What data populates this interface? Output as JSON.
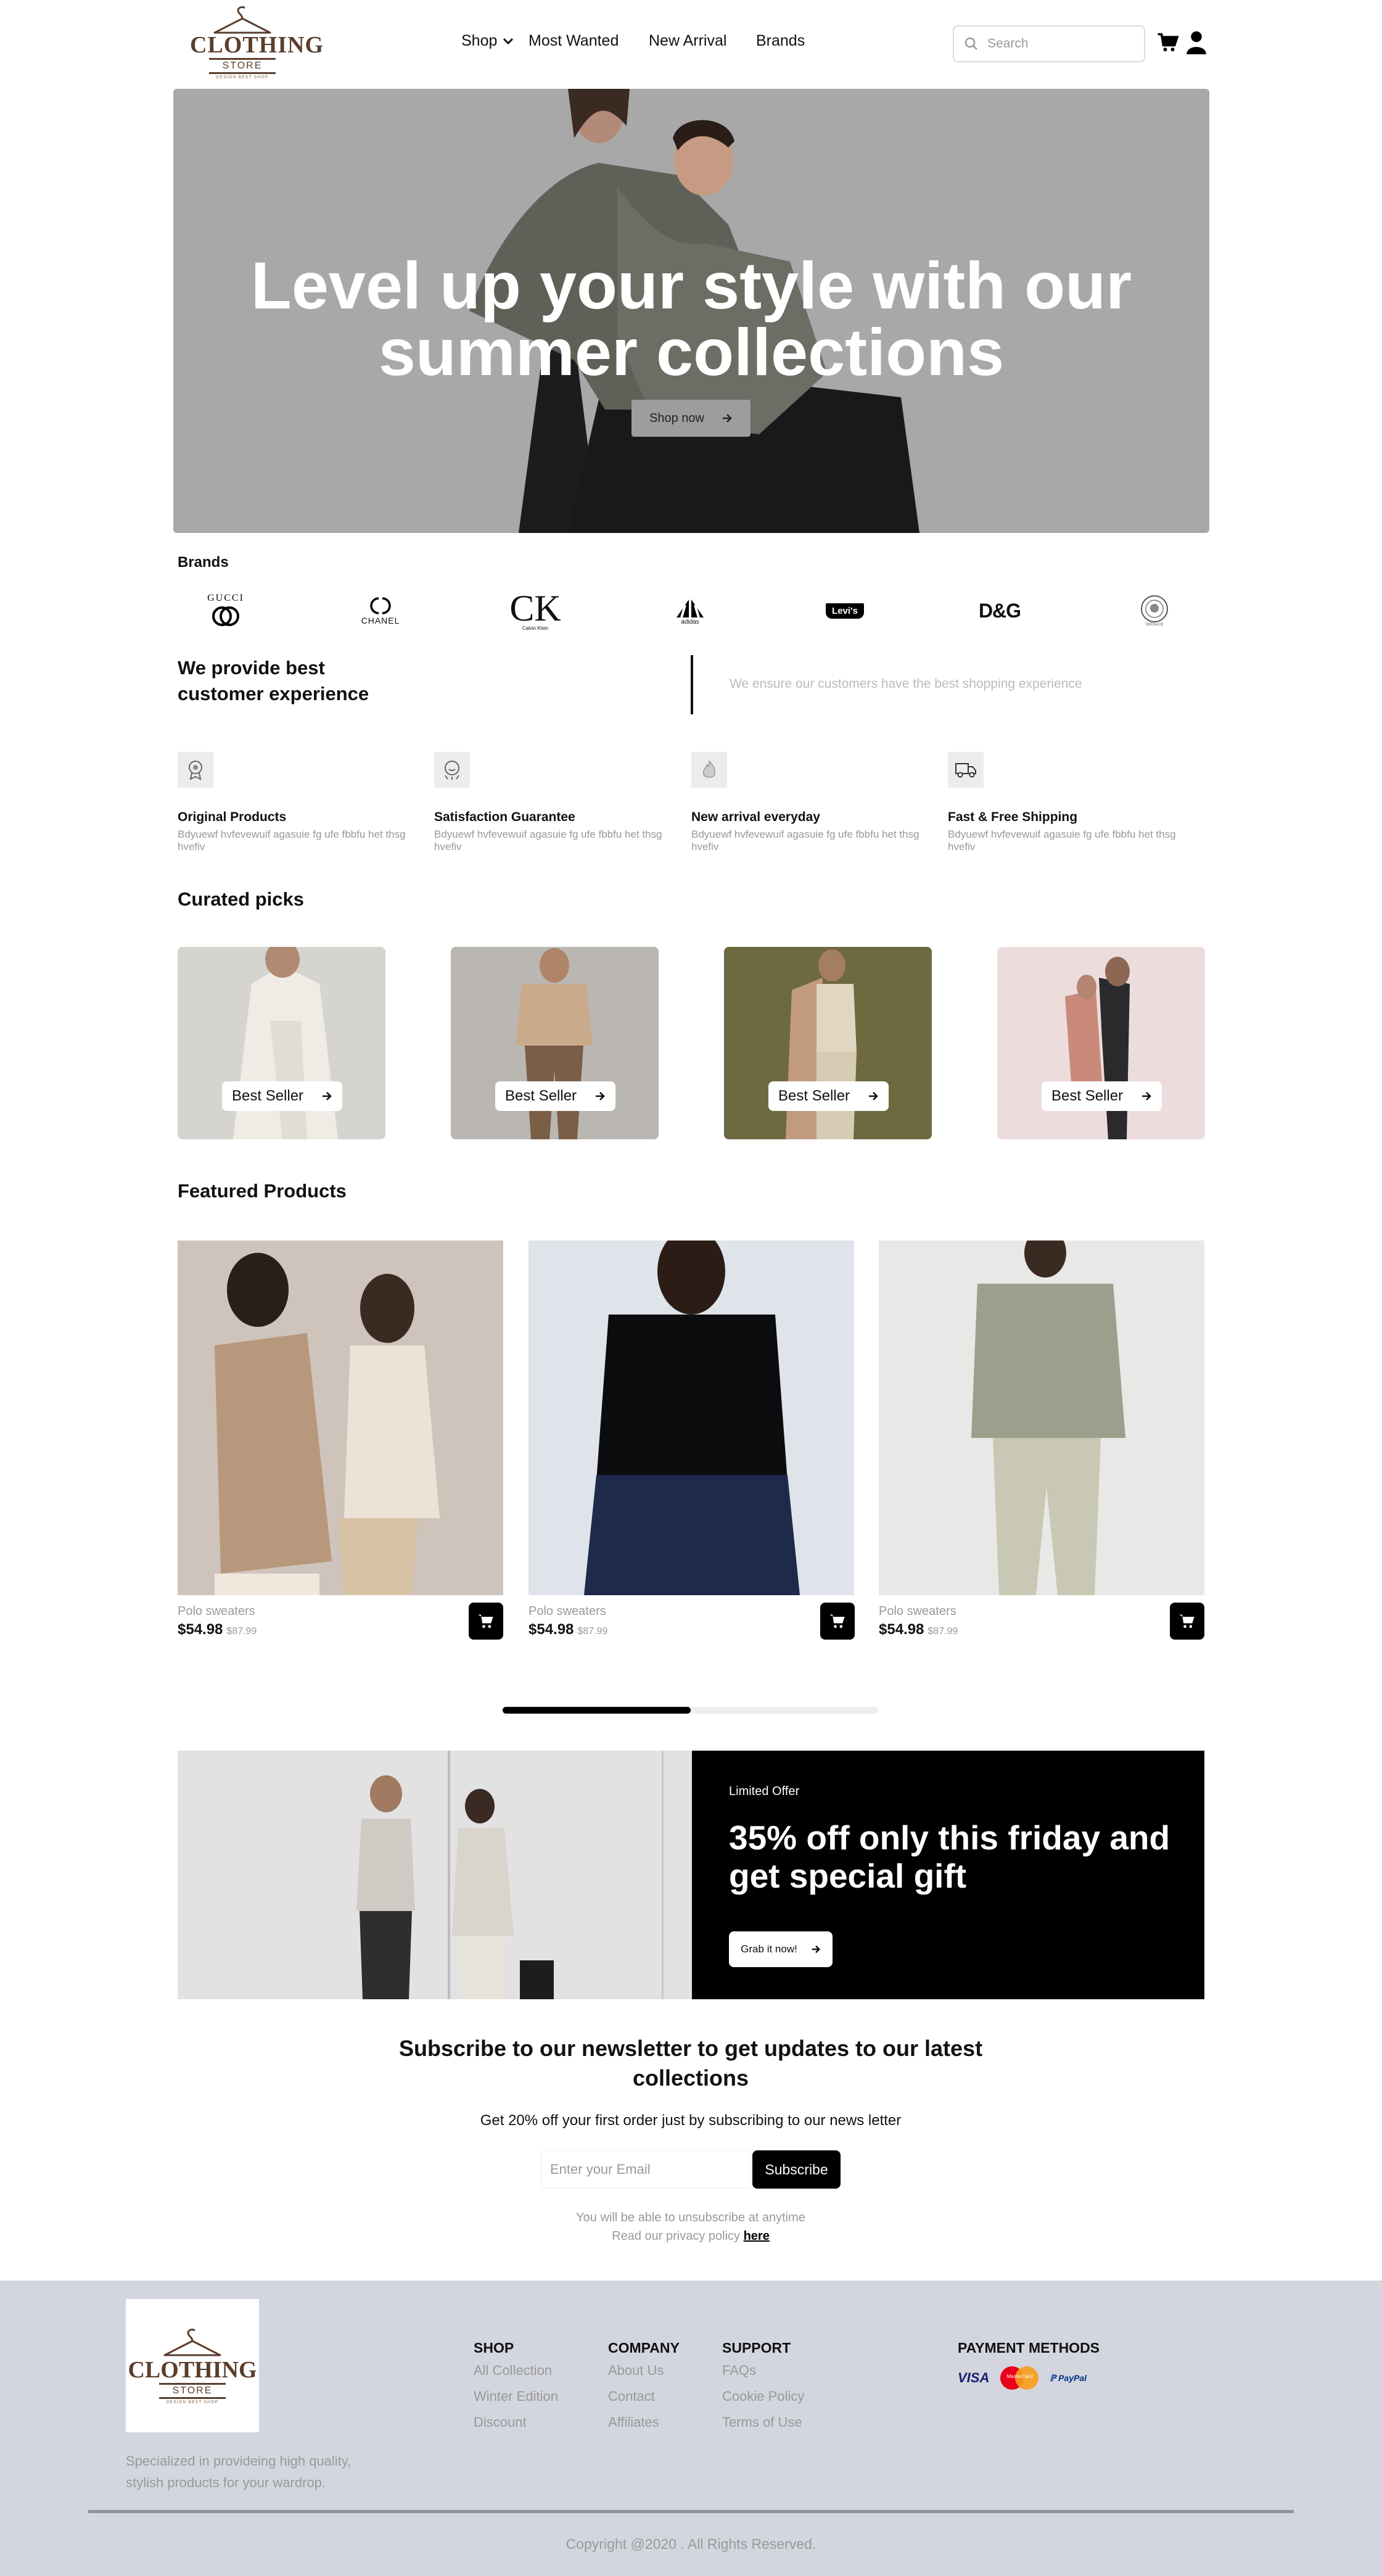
{
  "header": {
    "logo": {
      "line1": "CLOTHING",
      "line2": "STORE",
      "line3": "DESIGN BEST SHOP"
    },
    "nav": [
      {
        "label": "Shop"
      },
      {
        "label": "Most Wanted"
      },
      {
        "label": "New Arrival"
      },
      {
        "label": "Brands"
      }
    ],
    "search_placeholder": "Search"
  },
  "hero": {
    "title_line1": "Level up your style with our",
    "title_line2": "summer collections",
    "cta": "Shop now"
  },
  "brands": {
    "heading": "Brands",
    "items": [
      "GUCCI",
      "CHANEL",
      "Calvin Klein",
      "adidas",
      "Levi's",
      "D&G",
      "VERSACE"
    ]
  },
  "experience": {
    "heading_line1": "We provide best",
    "heading_line2": "customer experience",
    "tagline": "We ensure our customers have the best shopping experience"
  },
  "features": [
    {
      "title": "Original Products",
      "desc": "Bdyuewf hvfevewuif agasuie fg ufe fbbfu het thsg hvefiv",
      "icon": "badge-icon"
    },
    {
      "title": "Satisfaction Guarantee",
      "desc": "Bdyuewf hvfevewuif agasuie fg ufe fbbfu het thsg hvefiv",
      "icon": "smile-badge-icon"
    },
    {
      "title": "New arrival everyday",
      "desc": "Bdyuewf hvfevewuif agasuie fg ufe fbbfu het thsg hvefiv",
      "icon": "flame-icon"
    },
    {
      "title": "Fast & Free Shipping",
      "desc": "Bdyuewf hvfevewuif agasuie fg ufe fbbfu het thsg hvefiv",
      "icon": "truck-icon"
    }
  ],
  "curated": {
    "heading": "Curated picks",
    "items": [
      {
        "label": "Best Seller"
      },
      {
        "label": "Best Seller"
      },
      {
        "label": "Best Seller"
      },
      {
        "label": "Best Seller"
      }
    ]
  },
  "featured": {
    "heading": "Featured Products",
    "items": [
      {
        "name": "Polo sweaters",
        "price": "$54.98",
        "old_price": "$87.99"
      },
      {
        "name": "Polo sweaters",
        "price": "$54.98",
        "old_price": "$87.99"
      },
      {
        "name": "Polo sweaters",
        "price": "$54.98",
        "old_price": "$87.99"
      }
    ],
    "scroll_progress": 0.5
  },
  "promo": {
    "eyebrow": "Limited Offer",
    "title_line1": "35% off only this friday and",
    "title_line2": "get special gift",
    "cta": "Grab it now!"
  },
  "newsletter": {
    "title_line1": "Subscribe to our newsletter to get updates to our latest",
    "title_line2": "collections",
    "subtitle": "Get 20% off your first order just by subscribing to our news letter",
    "email_placeholder": "Enter your Email",
    "button": "Subscribe",
    "note1": "You will be able to unsubscribe at anytime",
    "note2_prefix": "Read our privacy policy",
    "note2_link": "here"
  },
  "footer": {
    "logo": {
      "line1": "CLOTHING",
      "line2": "STORE",
      "line3": "DESIGN BEST SHOP"
    },
    "about_line1": "Specialized in provideing high quality,",
    "about_line2": "stylish products for your wardrop.",
    "columns": [
      {
        "heading": "SHOP",
        "links": [
          "All Collection",
          "Winter Edition",
          "Discount"
        ]
      },
      {
        "heading": "COMPANY",
        "links": [
          "About Us",
          "Contact",
          "Affiliates"
        ]
      },
      {
        "heading": "SUPPORT",
        "links": [
          "FAQs",
          "Cookie Policy",
          "Terms of Use"
        ]
      }
    ],
    "payment_heading": "PAYMENT METHODS",
    "payments": [
      "VISA",
      "MasterCard",
      "PayPal"
    ],
    "copyright": "Copyright @2020 . All Rights Reserved."
  }
}
